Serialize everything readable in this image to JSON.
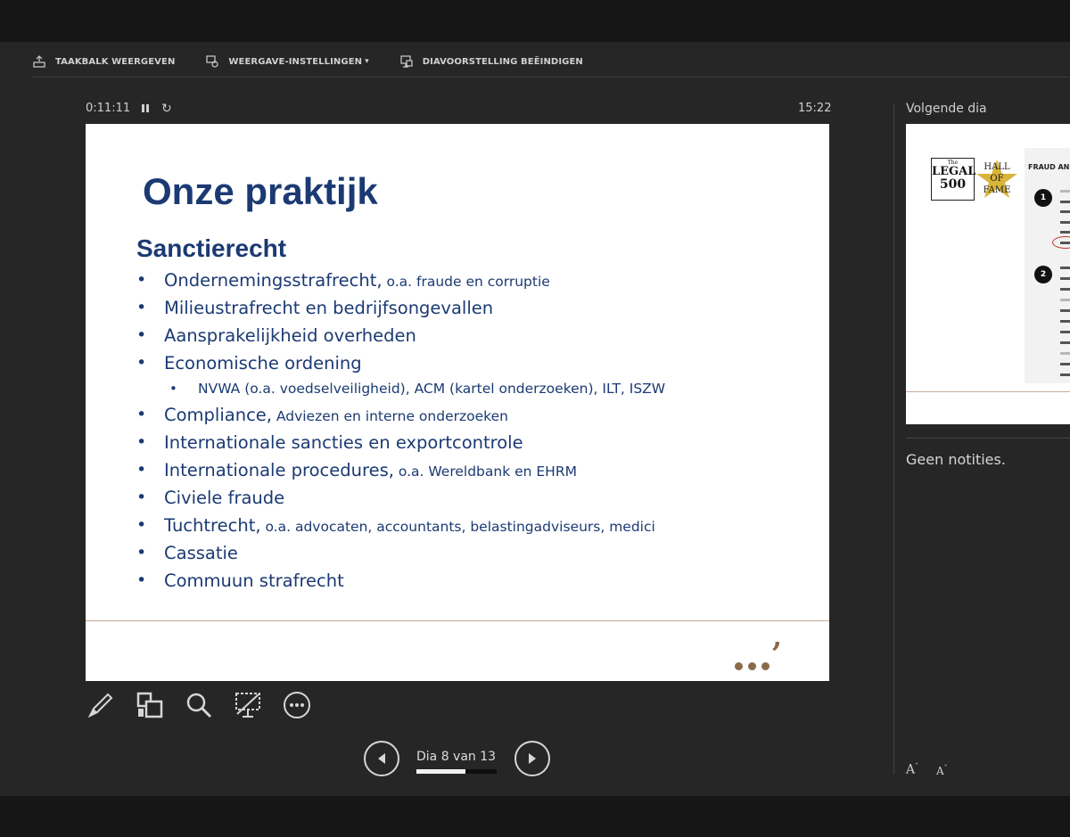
{
  "toolbar": {
    "show_taskbar": "TAAKBALK WEERGEVEN",
    "display_settings": "WEERGAVE-INSTELLINGEN",
    "display_settings_caret": "▾",
    "end_slideshow": "DIAVOORSTELLING BEËINDIGEN"
  },
  "timer": {
    "elapsed": "0:11:11",
    "clock": "15:22",
    "restart_glyph": "↻"
  },
  "slide": {
    "title": "Onze praktijk",
    "subtitle": "Sanctierecht",
    "bullets": [
      {
        "main": "Ondernemingsstrafrecht,",
        "detail": " o.a. fraude en corruptie"
      },
      {
        "main": "Milieustrafrecht en bedrijfsongevallen",
        "detail": ""
      },
      {
        "main": "Aansprakelijkheid overheden",
        "detail": ""
      },
      {
        "main": "Economische ordening",
        "detail": ""
      },
      {
        "main": "NVWA (o.a. voedselveiligheid), ACM (kartel onderzoeken), ILT, ISZW",
        "detail": ""
      },
      {
        "main": "Compliance,",
        "detail": " Adviezen en interne onderzoeken"
      },
      {
        "main": "Internationale sancties en exportcontrole",
        "detail": ""
      },
      {
        "main": "Internationale procedures,",
        "detail": " o.a. Wereldbank en EHRM"
      },
      {
        "main": "Civiele fraude",
        "detail": ""
      },
      {
        "main": "Tuchtrecht,",
        "detail": " o.a. advocaten, accountants, belastingadviseurs, medici"
      },
      {
        "main": "Cassatie",
        "detail": ""
      },
      {
        "main": "Commuun strafrecht",
        "detail": ""
      }
    ],
    "comma_mark": ","
  },
  "navigation": {
    "label": "Dia 8 van 13",
    "progress": 0.615
  },
  "next_slide": {
    "label": "Volgende dia",
    "logo_top": "The",
    "logo_mid": "LEGAL",
    "logo_bottom": "500",
    "hof_line1": "HALL",
    "hof_line2": "OF",
    "hof_line3": "FAME",
    "ranking_title": "FRAUD AN",
    "rank1": "1",
    "rank2": "2"
  },
  "notes": {
    "text": "Geen notities.",
    "font_up": "A",
    "font_down": "A",
    "font_up_mark": "˄",
    "font_down_mark": "˅"
  },
  "colors": {
    "background": "#262626",
    "slide_text": "#1b3a73",
    "accent_brown": "#8b6a4c"
  }
}
